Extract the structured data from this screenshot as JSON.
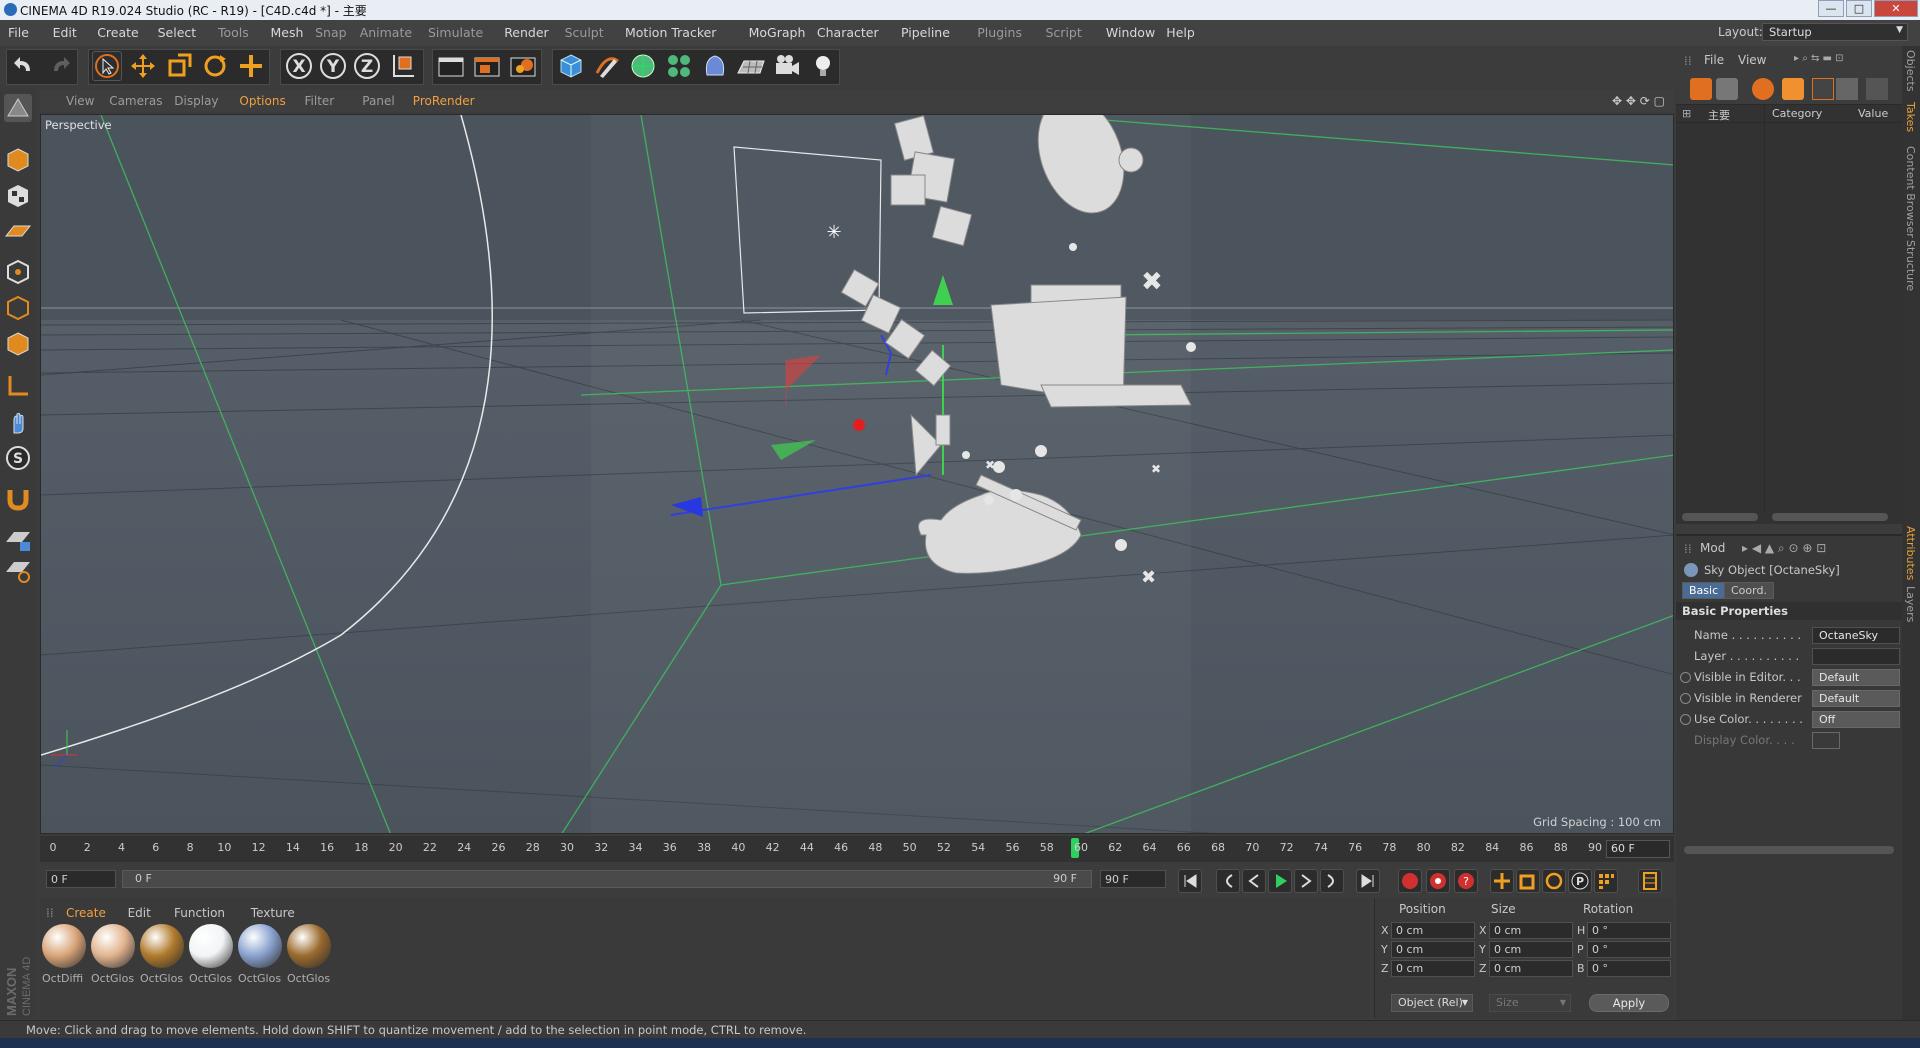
{
  "window": {
    "title": "CINEMA 4D R19.024 Studio (RC - R19) - [C4D.c4d *] - 主要",
    "min": "—",
    "max": "□",
    "close": "✕"
  },
  "menu": [
    {
      "label": "File",
      "dim": false
    },
    {
      "label": "Edit",
      "dim": false
    },
    {
      "label": "Create",
      "dim": false
    },
    {
      "label": "Select",
      "dim": false
    },
    {
      "label": "Tools",
      "dim": true
    },
    {
      "label": "Mesh",
      "dim": false
    },
    {
      "label": "Snap",
      "dim": true
    },
    {
      "label": "Animate",
      "dim": true
    },
    {
      "label": "Simulate",
      "dim": true
    },
    {
      "label": "Render",
      "dim": false
    },
    {
      "label": "Sculpt",
      "dim": true
    },
    {
      "label": "Motion Tracker",
      "dim": false
    },
    {
      "label": "MoGraph",
      "dim": false
    },
    {
      "label": "Character",
      "dim": false
    },
    {
      "label": "Pipeline",
      "dim": false
    },
    {
      "label": "Plugins",
      "dim": true
    },
    {
      "label": "Script",
      "dim": true
    },
    {
      "label": "Window",
      "dim": false
    },
    {
      "label": "Help",
      "dim": false
    }
  ],
  "layout": {
    "label": "Layout:",
    "value": "Startup"
  },
  "toolbar_icons": [
    "undo-icon",
    "redo-icon",
    "select-arrow-icon",
    "move-icon",
    "scale-icon",
    "rotate-icon",
    "live-select-icon",
    "x-axis-icon",
    "y-axis-icon",
    "z-axis-icon",
    "coordinate-system-icon",
    "render-view-icon",
    "render-picture-viewer-icon",
    "render-settings-icon",
    "cube-icon",
    "pen-icon",
    "subdivision-icon",
    "cloner-icon",
    "deformer-icon",
    "floor-icon",
    "camera-icon",
    "light-icon"
  ],
  "axis_labels": {
    "x": "X",
    "y": "Y",
    "z": "Z"
  },
  "viewport": {
    "menu": [
      {
        "label": "View",
        "on": false
      },
      {
        "label": "Cameras",
        "on": false
      },
      {
        "label": "Display",
        "on": false
      },
      {
        "label": "Options",
        "on": true
      },
      {
        "label": "Filter",
        "on": false
      },
      {
        "label": "Panel",
        "on": false
      },
      {
        "label": "ProRender",
        "on": true
      }
    ],
    "name": "Perspective",
    "grid_spacing": "Grid Spacing : 100 cm"
  },
  "timeline": {
    "ticks": [
      "0",
      "2",
      "4",
      "6",
      "8",
      "10",
      "12",
      "14",
      "16",
      "18",
      "20",
      "22",
      "24",
      "26",
      "28",
      "30",
      "32",
      "34",
      "36",
      "38",
      "40",
      "42",
      "44",
      "46",
      "48",
      "50",
      "52",
      "54",
      "56",
      "58",
      "60",
      "62",
      "64",
      "66",
      "68",
      "70",
      "72",
      "74",
      "76",
      "78",
      "80",
      "82",
      "84",
      "86",
      "88",
      "90"
    ],
    "current": 60,
    "current_label": "60 F",
    "start_field": "0 F",
    "slider_start": "0 F",
    "slider_end": "90 F",
    "end_field": "90 F"
  },
  "materials": {
    "menu": [
      "Create",
      "Edit",
      "Function",
      "Texture"
    ],
    "items": [
      {
        "label": "OctDiffi",
        "color": "#d9a57a"
      },
      {
        "label": "OctGlos",
        "color": "#e1b48e"
      },
      {
        "label": "OctGlos",
        "color": "#b07a2c"
      },
      {
        "label": "OctGlos",
        "color": "#f2f4f6"
      },
      {
        "label": "OctGlos",
        "color": "#8aa2cf"
      },
      {
        "label": "OctGlos",
        "color": "#9a6a2e"
      }
    ]
  },
  "coordinates": {
    "headers": [
      "Position",
      "Size",
      "Rotation"
    ],
    "rows": [
      {
        "pa": "X",
        "pv": "0 cm",
        "sa": "X",
        "sv": "0 cm",
        "ra": "H",
        "rv": "0 °"
      },
      {
        "pa": "Y",
        "pv": "0 cm",
        "sa": "Y",
        "sv": "0 cm",
        "ra": "P",
        "rv": "0 °"
      },
      {
        "pa": "Z",
        "pv": "0 cm",
        "sa": "Z",
        "sv": "0 cm",
        "ra": "B",
        "rv": "0 °"
      }
    ],
    "mode": "Object (Rel)",
    "size_mode": "Size",
    "apply": "Apply"
  },
  "objects": {
    "menu": [
      "File",
      "View"
    ],
    "columns": [
      "主要",
      "Category",
      "Value"
    ]
  },
  "attributes": {
    "mode": "Mod",
    "object": "Sky Object [OctaneSky]",
    "tabs": [
      {
        "label": "Basic",
        "on": true
      },
      {
        "label": "Coord.",
        "on": false
      }
    ],
    "section": "Basic Properties",
    "props": [
      {
        "label": "Name . . . . . . . . . .",
        "value": "OctaneSky",
        "radio": false,
        "dark": true
      },
      {
        "label": "Layer . . . . . . . . . .",
        "value": "",
        "radio": false,
        "dark": true
      },
      {
        "label": "Visible in Editor. . .",
        "value": "Default",
        "radio": true,
        "dark": false
      },
      {
        "label": "Visible in Renderer",
        "value": "Default",
        "radio": true,
        "dark": false
      },
      {
        "label": "Use Color. . . . . . . .",
        "value": "Off",
        "radio": true,
        "dark": false
      },
      {
        "label": "Display Color. . . .",
        "value": "",
        "radio": false,
        "dark": false
      }
    ]
  },
  "side_tabs": [
    {
      "label": "Objects",
      "on": false
    },
    {
      "label": "Takes",
      "on": true
    },
    {
      "label": "Content Browser",
      "on": false
    },
    {
      "label": "Structure",
      "on": false
    },
    {
      "label": "Attributes",
      "on": true
    },
    {
      "label": "Layers",
      "on": false
    }
  ],
  "brand": [
    "MAXON",
    "CINEMA 4D"
  ],
  "status": "Move: Click and drag to move elements. Hold down SHIFT to quantize movement / add to the selection in point mode, CTRL to remove."
}
